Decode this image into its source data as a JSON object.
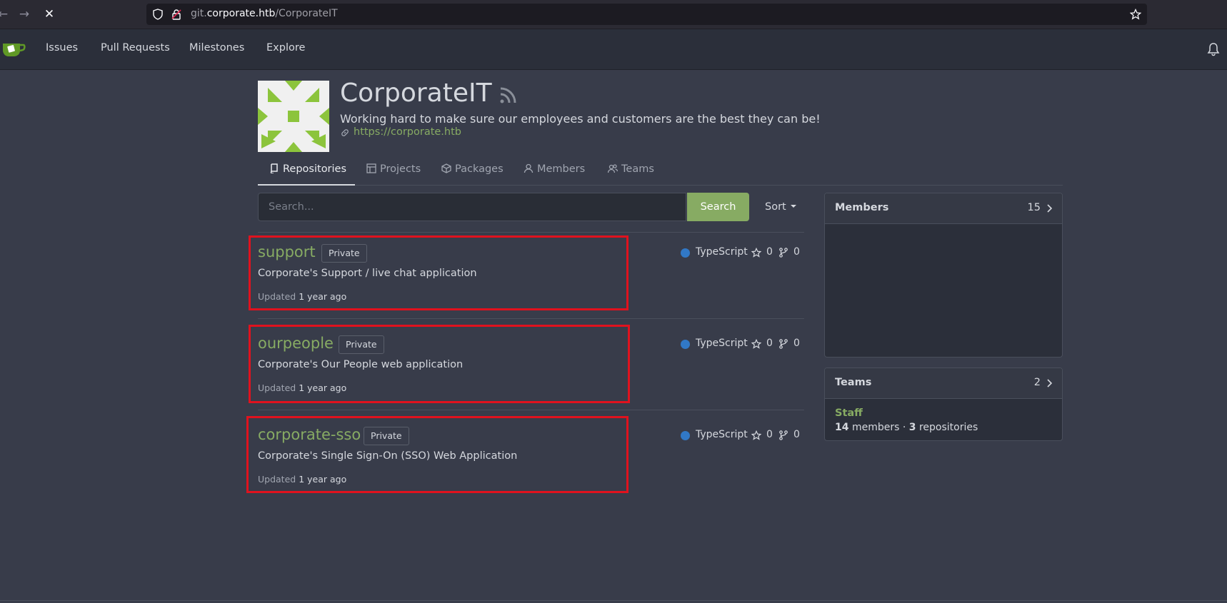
{
  "browser": {
    "url_host_prefix": "git.",
    "url_host": "corporate.htb",
    "url_path": "/CorporateIT"
  },
  "nav": {
    "items": [
      "Issues",
      "Pull Requests",
      "Milestones",
      "Explore"
    ]
  },
  "org": {
    "name": "CorporateIT",
    "description": "Working hard to make sure our employees and customers are the best they can be!",
    "website": "https://corporate.htb"
  },
  "tabs": [
    "Repositories",
    "Projects",
    "Packages",
    "Members",
    "Teams"
  ],
  "search": {
    "placeholder": "Search...",
    "button": "Search",
    "sort_label": "Sort"
  },
  "repos": [
    {
      "name": "support",
      "visibility": "Private",
      "description": "Corporate's Support / live chat application",
      "updated_prefix": "Updated",
      "updated_time": "1 year ago",
      "language": "TypeScript",
      "stars": "0",
      "forks": "0"
    },
    {
      "name": "ourpeople",
      "visibility": "Private",
      "description": "Corporate's Our People web application",
      "updated_prefix": "Updated",
      "updated_time": "1 year ago",
      "language": "TypeScript",
      "stars": "0",
      "forks": "0"
    },
    {
      "name": "corporate-sso",
      "visibility": "Private",
      "description": "Corporate's Single Sign-On (SSO) Web Application",
      "updated_prefix": "Updated",
      "updated_time": "1 year ago",
      "language": "TypeScript",
      "stars": "0",
      "forks": "0"
    }
  ],
  "sidebar": {
    "members": {
      "title": "Members",
      "count": "15"
    },
    "teams": {
      "title": "Teams",
      "count": "2",
      "items": [
        {
          "name": "Staff",
          "members": "14",
          "members_label": "members",
          "separator": "·",
          "repos": "3",
          "repos_label": "repositories"
        }
      ]
    }
  },
  "colors": {
    "accent_green": "#87ab63",
    "typescript": "#3178c6",
    "highlight_red": "#e0121e",
    "background": "#383c4a"
  }
}
